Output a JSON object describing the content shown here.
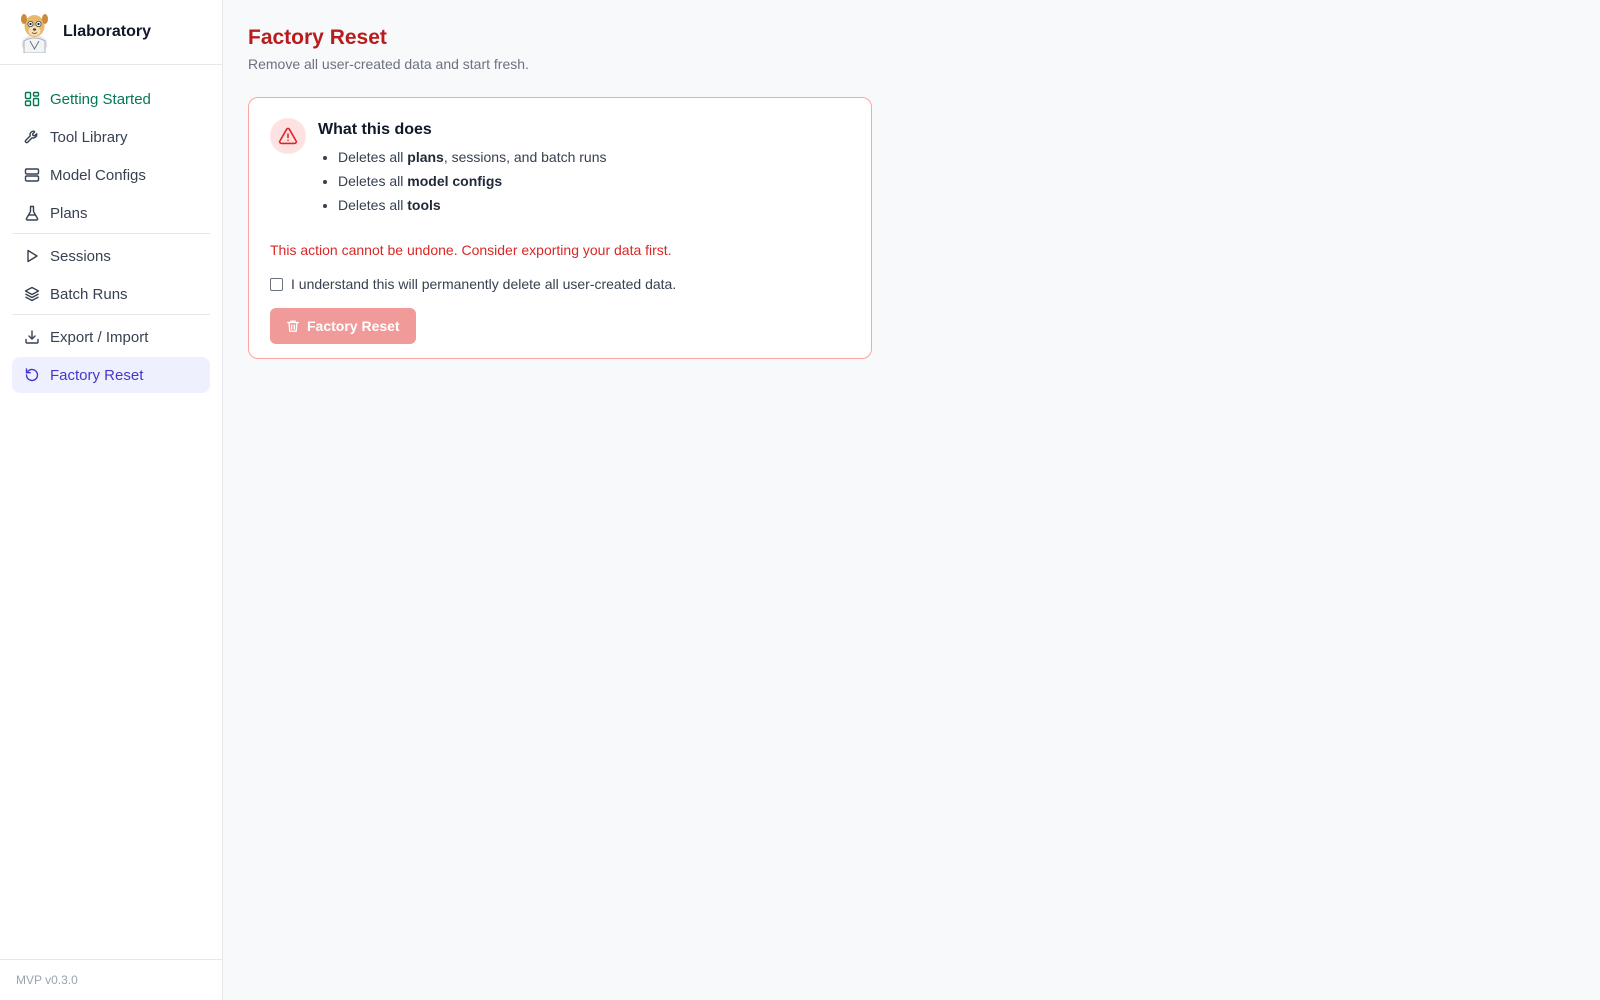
{
  "app": {
    "name": "Llaboratory",
    "version": "MVP v0.3.0"
  },
  "sidebar": {
    "items": [
      {
        "label": "Getting Started",
        "icon": "dashboard-icon"
      },
      {
        "label": "Tool Library",
        "icon": "wrench-icon"
      },
      {
        "label": "Model Configs",
        "icon": "server-icon"
      },
      {
        "label": "Plans",
        "icon": "flask-icon"
      },
      {
        "label": "Sessions",
        "icon": "play-icon"
      },
      {
        "label": "Batch Runs",
        "icon": "layers-icon"
      },
      {
        "label": "Export / Import",
        "icon": "download-icon"
      },
      {
        "label": "Factory Reset",
        "icon": "rotate-ccw-icon"
      }
    ],
    "active": "Factory Reset"
  },
  "page": {
    "title": "Factory Reset",
    "subtitle": "Remove all user-created data and start fresh."
  },
  "card": {
    "heading": "What this does",
    "bullets": [
      {
        "prefix": "Deletes all ",
        "bold": "plans",
        "suffix": ", sessions, and batch runs"
      },
      {
        "prefix": "Deletes all ",
        "bold": "model configs",
        "suffix": ""
      },
      {
        "prefix": "Deletes all ",
        "bold": "tools",
        "suffix": ""
      }
    ],
    "warning": "This action cannot be undone. Consider exporting your data first.",
    "confirm_label": "I understand this will permanently delete all user-created data.",
    "confirm_checked": false,
    "button_label": "Factory Reset"
  },
  "colors": {
    "danger": "#dc2626",
    "title": "#b91c1c",
    "active_nav_bg": "#eef0fe",
    "active_nav_text": "#4338ca",
    "getting_started_text": "#047857",
    "button_disabled_bg": "#f19a9a"
  }
}
